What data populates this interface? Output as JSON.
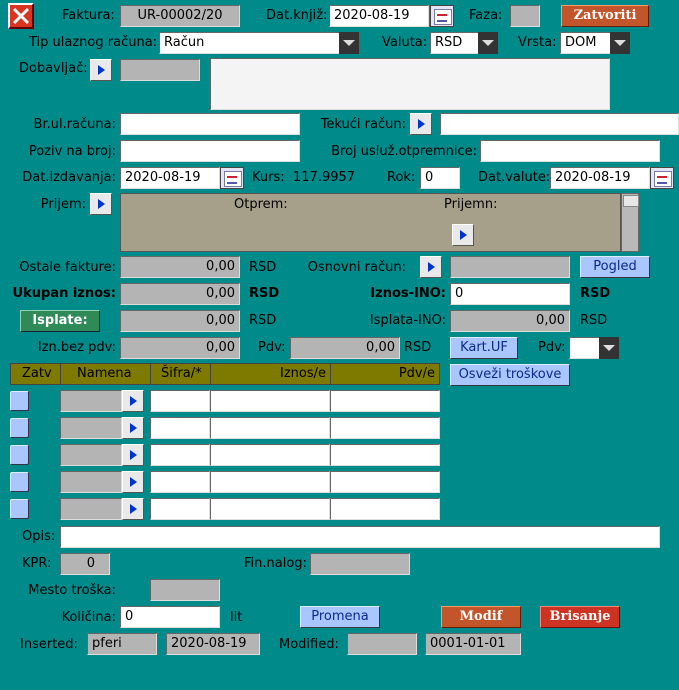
{
  "header": {
    "faktura_label": "Faktura:",
    "faktura_value": "UR-00002/20",
    "datkjiz_label": "Dat.knjiž:",
    "datkjiz_value": "2020-08-19",
    "faza_label": "Faza:",
    "faza_value": "",
    "close_button": "Zatvoriti"
  },
  "tip": {
    "label": "Tip ulaznog računa:",
    "value": "Račun"
  },
  "valuta": {
    "label": "Valuta:",
    "value": "RSD"
  },
  "vrsta": {
    "label": "Vrsta:",
    "value": "DOM"
  },
  "dobavljac": {
    "label": "Dobavljač:",
    "code": "",
    "description": ""
  },
  "brulracuna": {
    "label": "Br.ul.računa:",
    "value": ""
  },
  "tekuci": {
    "label": "Tekući račun:",
    "value": ""
  },
  "poziv": {
    "label": "Poziv na broj:",
    "value": ""
  },
  "usluz": {
    "label": "Broj usluž.otpremnice:",
    "value": ""
  },
  "datizd": {
    "label": "Dat.izdavanja:",
    "value": "2020-08-19"
  },
  "kurs": {
    "label": "Kurs:",
    "value": "117.9957"
  },
  "rok": {
    "label": "Rok:",
    "value": "0"
  },
  "datval": {
    "label": "Dat.valute:",
    "value": "2020-08-19"
  },
  "prijem": {
    "label": "Prijem:",
    "otprem_label": "Otprem:",
    "prijemn_label": "Prijemn:"
  },
  "ostale": {
    "label": "Ostale fakture:",
    "value": "0,00",
    "currency": "RSD"
  },
  "osnovni": {
    "label": "Osnovni račun:",
    "value": "",
    "button": "Pogled"
  },
  "ukupan": {
    "label": "Ukupan iznos:",
    "value": "0,00",
    "currency": "RSD"
  },
  "iznosino": {
    "label": "Iznos-INO:",
    "value": "0",
    "currency": "RSD"
  },
  "isplate": {
    "button": "Isplate:",
    "value": "0,00",
    "currency": "RSD"
  },
  "isplataino": {
    "label": "Isplata-INO:",
    "value": "0,00",
    "currency": "RSD"
  },
  "iznbez": {
    "label": "Izn.bez pdv:",
    "value": "0,00"
  },
  "pdv": {
    "label": "Pdv:",
    "value": "0,00",
    "currency": "RSD"
  },
  "kartuf": {
    "button": "Kart.UF"
  },
  "pdvsel": {
    "label": "Pdv:",
    "value": ""
  },
  "osvezi": {
    "button": "Osveži troškove"
  },
  "table": {
    "columns": [
      "Zatv",
      "Namena",
      "Šifra/*",
      "Iznos/e",
      "Pdv/e"
    ],
    "rows": [
      {
        "namena": "",
        "sifra": "",
        "iznos": "",
        "pdv": ""
      },
      {
        "namena": "",
        "sifra": "",
        "iznos": "",
        "pdv": ""
      },
      {
        "namena": "",
        "sifra": "",
        "iznos": "",
        "pdv": ""
      },
      {
        "namena": "",
        "sifra": "",
        "iznos": "",
        "pdv": ""
      },
      {
        "namena": "",
        "sifra": "",
        "iznos": "",
        "pdv": ""
      }
    ]
  },
  "opis": {
    "label": "Opis:",
    "value": ""
  },
  "kpr": {
    "label": "KPR:",
    "value": "0"
  },
  "finnalog": {
    "label": "Fin.nalog:",
    "value": ""
  },
  "mesto": {
    "label": "Mesto troška:",
    "value": ""
  },
  "kolicina": {
    "label": "Količina:",
    "value": "0",
    "unit": "lit"
  },
  "actions": {
    "promena": "Promena",
    "modif": "Modif",
    "brisanje": "Brisanje"
  },
  "audit": {
    "inserted_label": "Inserted:",
    "inserted_by": "pferi",
    "inserted_date": "2020-08-19",
    "modified_label": "Modified:",
    "modified_by": "",
    "modified_date": "0001-01-01"
  },
  "colors": {
    "background": "#008a8a",
    "close_button": "#cc3322",
    "table_header": "#7e7a00",
    "readonly_field": "#b4b4b4",
    "action_blue": "#a9c6ff"
  }
}
